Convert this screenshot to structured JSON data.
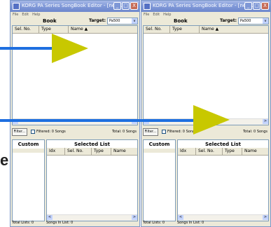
{
  "windows": [
    {
      "title": "KORG PA Series SongBook Editor - [new ...",
      "menu": [
        "File",
        "Edit",
        "Help"
      ],
      "book_label": "Book",
      "target_label": "Target:",
      "target_value": "Pa500",
      "columns": [
        "Sel. No.",
        "Type",
        "Name"
      ],
      "sort_glyph": "▲",
      "filter_button": "Filter...",
      "filtered_label": "Filtered: 0 Songs",
      "total_label": "Total: 0 Songs",
      "custom_title": "Custom",
      "selected_title": "Selected List",
      "selected_columns": [
        "Idx",
        "Sel. No.",
        "Type",
        "Name"
      ],
      "total_lists": "Total Lists: 0",
      "songs_in_list": "Songs In List: 0"
    },
    {
      "title": "KORG PA Series SongBook Editor - [new ...",
      "menu": [
        "File",
        "Edit",
        "Help"
      ],
      "book_label": "Book",
      "target_label": "Target:",
      "target_value": "Pa500",
      "columns": [
        "Sel. No.",
        "Type",
        "Name"
      ],
      "sort_glyph": "▲",
      "filter_button": "Filter...",
      "filtered_label": "Filtered: 0 Songs",
      "total_label": "Total: 0 Songs",
      "custom_title": "Custom",
      "selected_title": "Selected List",
      "selected_columns": [
        "Idx",
        "Sel. No.",
        "Type",
        "Name"
      ],
      "total_lists": "Total Lists: 0",
      "songs_in_list": "Songs In List: 0"
    }
  ],
  "overlay": {
    "side_letter": "e",
    "arrow_line_color": "#1e6fe0",
    "arrow_head_color": "#c8c800"
  },
  "titlebar_buttons": [
    "_",
    "□",
    "X"
  ],
  "scroll_glyphs": [
    "<",
    ">"
  ],
  "dropdown_glyph": "v"
}
